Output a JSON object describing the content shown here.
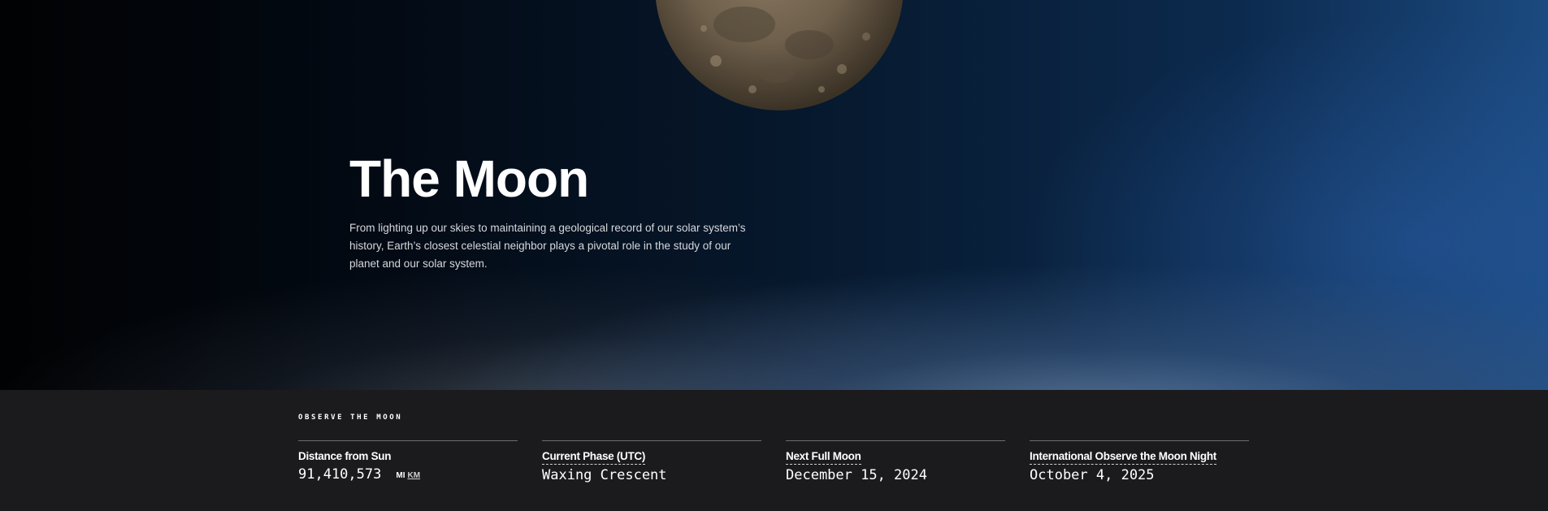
{
  "hero": {
    "title": "The Moon",
    "description": "From lighting up our skies to maintaining a geological record of our solar system’s history, Earth’s closest celestial neighbor plays a pivotal role in the study of our planet and our solar system."
  },
  "observe": {
    "section_label": "OBSERVE THE MOON",
    "stats": [
      {
        "title": "Distance from Sun",
        "value": "91,410,573",
        "units": [
          "MI",
          "KM"
        ]
      },
      {
        "title": "Current Phase (UTC)",
        "value": "Waxing Crescent"
      },
      {
        "title": "Next Full Moon",
        "value": "December 15, 2024"
      },
      {
        "title": "International Observe the Moon Night",
        "value": "October 4, 2025"
      }
    ]
  },
  "colors": {
    "bar_background": "#1b1b1e",
    "text": "#ffffff",
    "divider": "#6c6d70"
  }
}
